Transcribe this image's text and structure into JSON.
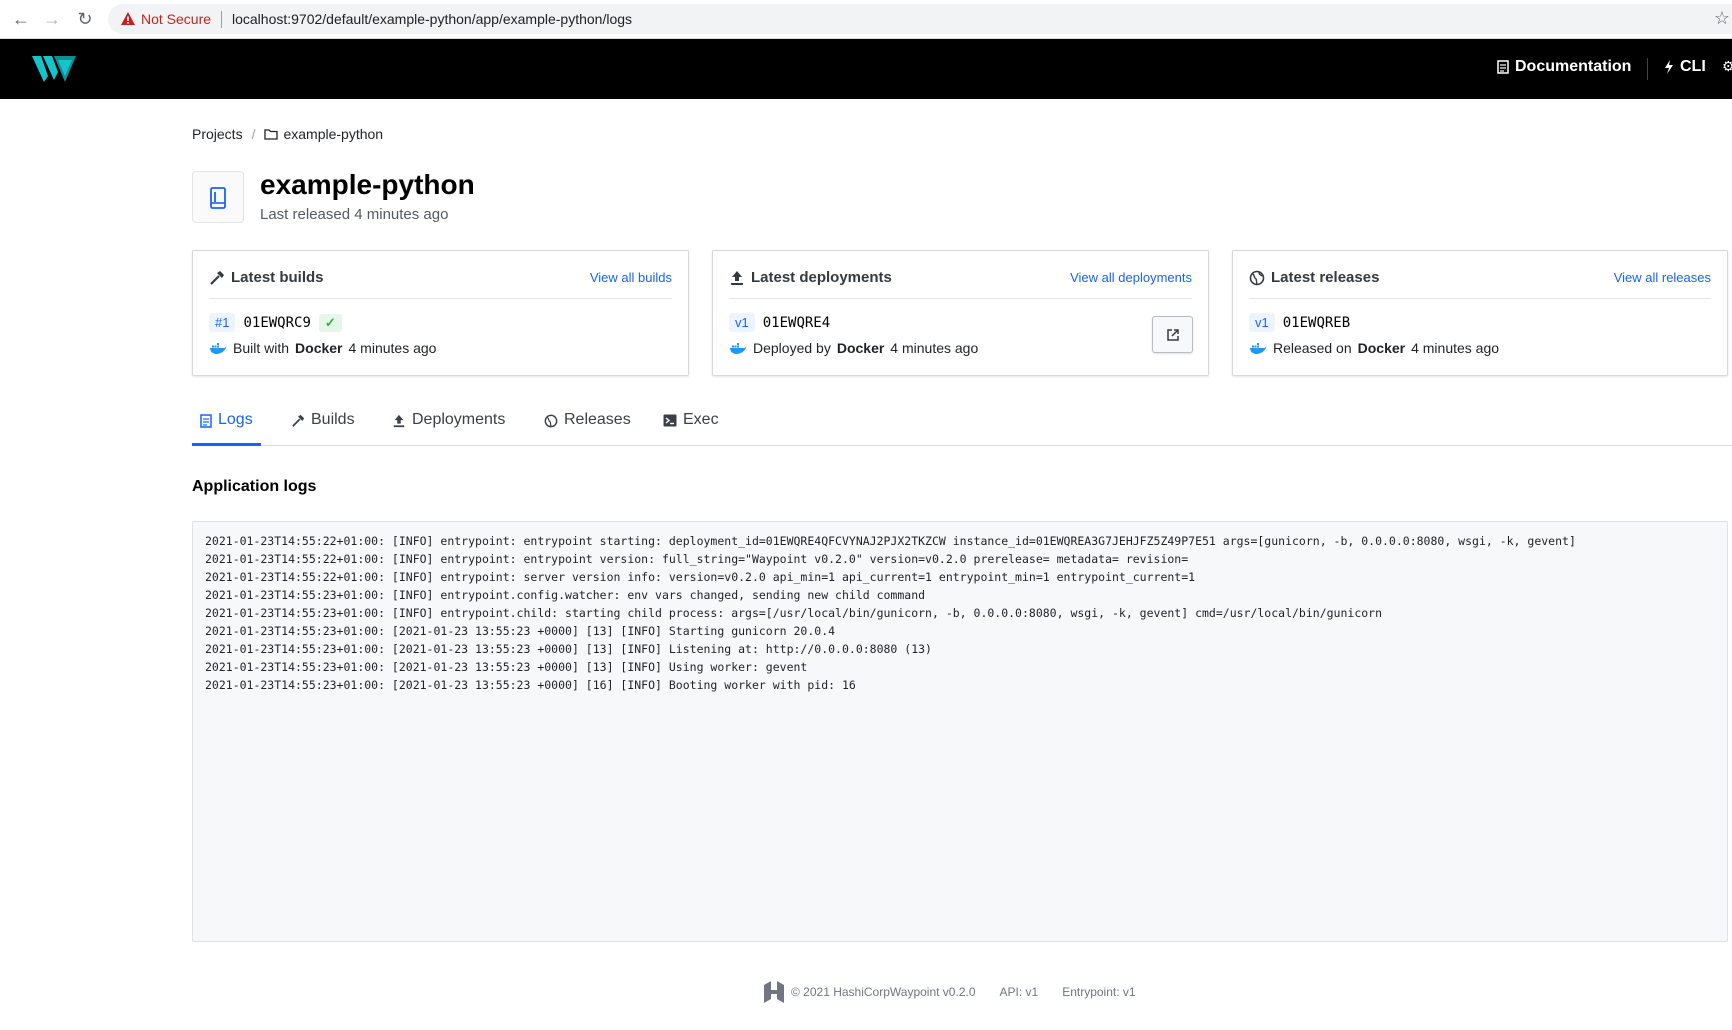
{
  "browser": {
    "security_label": "Not Secure",
    "url": "localhost:9702/default/example-python/app/example-python/logs"
  },
  "topbar": {
    "documentation_label": "Documentation",
    "cli_label": "CLI"
  },
  "breadcrumb": {
    "projects": "Projects",
    "project": "example-python"
  },
  "app": {
    "title": "example-python",
    "subtitle": "Last released 4 minutes ago"
  },
  "cards": {
    "builds": {
      "title": "Latest builds",
      "link": "View all builds",
      "badge": "#1",
      "id": "01EWQRC9",
      "status_icon": "✓",
      "detail_prefix": "Built with",
      "detail_tool": "Docker",
      "detail_suffix": "4 minutes ago"
    },
    "deployments": {
      "title": "Latest deployments",
      "link": "View all deployments",
      "badge": "v1",
      "id": "01EWQRE4",
      "detail_prefix": "Deployed by",
      "detail_tool": "Docker",
      "detail_suffix": "4 minutes ago"
    },
    "releases": {
      "title": "Latest releases",
      "link": "View all releases",
      "badge": "v1",
      "id": "01EWQREB",
      "detail_prefix": "Released on",
      "detail_tool": "Docker",
      "detail_suffix": "4 minutes ago"
    }
  },
  "tabs": [
    {
      "label": "Logs",
      "active": true
    },
    {
      "label": "Builds",
      "active": false
    },
    {
      "label": "Deployments",
      "active": false
    },
    {
      "label": "Releases",
      "active": false
    },
    {
      "label": "Exec",
      "active": false
    }
  ],
  "logs": {
    "heading": "Application logs",
    "lines": [
      "2021-01-23T14:55:22+01:00: [INFO] entrypoint: entrypoint starting: deployment_id=01EWQRE4QFCVYNAJ2PJX2TKZCW instance_id=01EWQREA3G7JEHJFZ5Z49P7E51 args=[gunicorn, -b, 0.0.0.0:8080, wsgi, -k, gevent]",
      "2021-01-23T14:55:22+01:00: [INFO] entrypoint: entrypoint version: full_string=\"Waypoint v0.2.0\" version=v0.2.0 prerelease= metadata= revision=",
      "2021-01-23T14:55:22+01:00: [INFO] entrypoint: server version info: version=v0.2.0 api_min=1 api_current=1 entrypoint_min=1 entrypoint_current=1",
      "2021-01-23T14:55:23+01:00: [INFO] entrypoint.config.watcher: env vars changed, sending new child command",
      "2021-01-23T14:55:23+01:00: [INFO] entrypoint.child: starting child process: args=[/usr/local/bin/gunicorn, -b, 0.0.0.0:8080, wsgi, -k, gevent] cmd=/usr/local/bin/gunicorn",
      "2021-01-23T14:55:23+01:00: [2021-01-23 13:55:23 +0000] [13] [INFO] Starting gunicorn 20.0.4",
      "2021-01-23T14:55:23+01:00: [2021-01-23 13:55:23 +0000] [13] [INFO] Listening at: http://0.0.0.0:8080 (13)",
      "2021-01-23T14:55:23+01:00: [2021-01-23 13:55:23 +0000] [13] [INFO] Using worker: gevent",
      "2021-01-23T14:55:23+01:00: [2021-01-23 13:55:23 +0000] [16] [INFO] Booting worker with pid: 16"
    ]
  },
  "footer": {
    "copyright": "© 2021 HashiCorpWaypoint v0.2.0",
    "api": "API: v1",
    "entrypoint": "Entrypoint: v1"
  },
  "colors": {
    "accent": "#1563ff",
    "brand_teal": "#14c6cb",
    "header_bg": "#000000",
    "success": "#2eb039",
    "warning": "#c5221f"
  }
}
